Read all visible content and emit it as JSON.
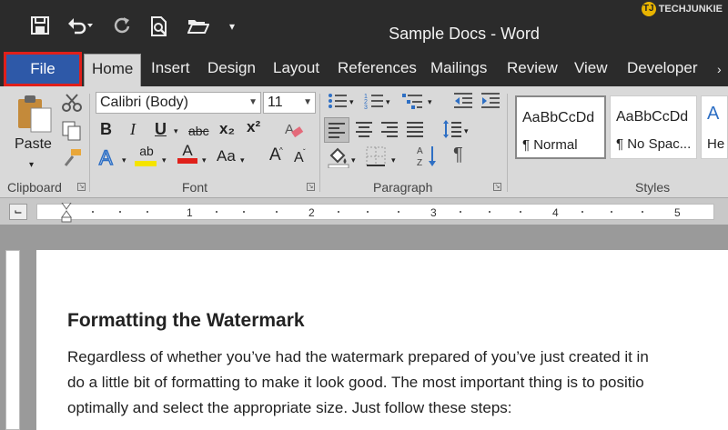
{
  "title_bar": {
    "doc_title": "Sample Docs - Word",
    "watermark": "TECHJUNKIE",
    "qat_icons": [
      "save-icon",
      "undo-icon",
      "redo-icon",
      "print-preview-icon",
      "open-folder-icon",
      "customize-qat-icon"
    ]
  },
  "tabs": {
    "file": "File",
    "home": "Home",
    "insert": "Insert",
    "design": "Design",
    "layout": "Layout",
    "references": "References",
    "mailings": "Mailings",
    "review": "Review",
    "view": "View",
    "developer": "Developer"
  },
  "ribbon": {
    "clipboard": {
      "paste": "Paste",
      "label": "Clipboard"
    },
    "font": {
      "font_name": "Calibri (Body)",
      "font_size": "11",
      "bold": "B",
      "italic": "I",
      "underline": "U",
      "strikethrough": "abc",
      "subscript": "x₂",
      "superscript": "x²",
      "change_case": "Aa",
      "grow_font": "A",
      "shrink_font": "A",
      "font_color_letter": "A",
      "highlight_letters": "ab",
      "label": "Font"
    },
    "paragraph": {
      "label": "Paragraph",
      "show_marks": "¶"
    },
    "styles": {
      "label": "Styles",
      "items": [
        {
          "sample": "AaBbCcDd",
          "name": "¶ Normal"
        },
        {
          "sample": "AaBbCcDd",
          "name": "¶ No Spac..."
        },
        {
          "sample": "A",
          "name": "He"
        }
      ]
    }
  },
  "ruler": {
    "numbers": [
      "1",
      "2",
      "3",
      "4",
      "5"
    ]
  },
  "document": {
    "heading": "Formatting the Watermark",
    "lines": [
      "Regardless of whether you’ve had the watermark prepared of you’ve just created it in",
      "do a little bit of formatting to make it look good. The most important thing is to positio",
      "optimally and select the appropriate size. Just follow these steps:"
    ]
  },
  "colors": {
    "file_tab": "#2e59a8",
    "file_highlight": "#e0201a",
    "title_bar": "#2b2b2b",
    "ribbon": "#d9d9d9",
    "font_color": "#e0201a",
    "highlight_color": "#f5e400"
  }
}
